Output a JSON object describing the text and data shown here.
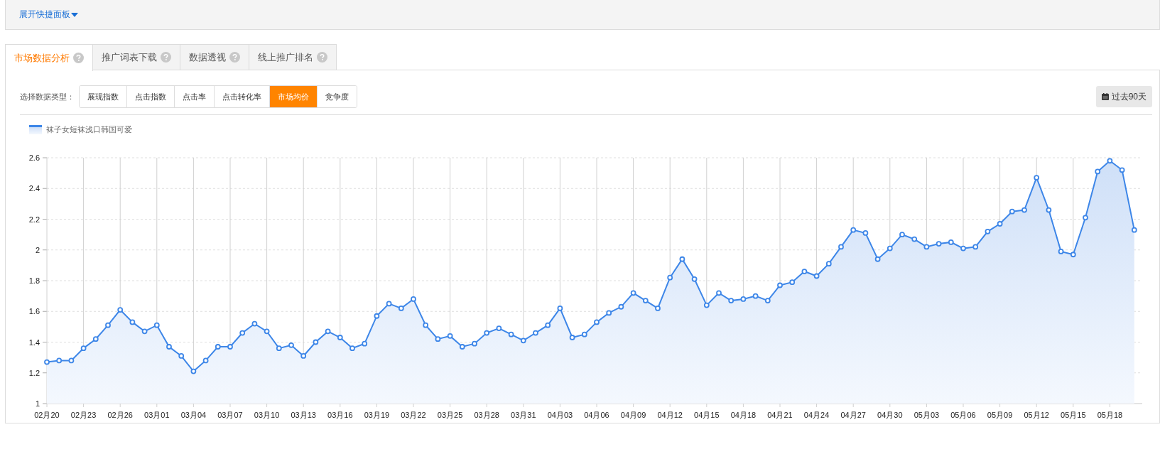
{
  "quick_panel": {
    "label": "展开快捷面板"
  },
  "tabs": [
    {
      "label": "市场数据分析",
      "selected": true
    },
    {
      "label": "推广词表下载",
      "selected": false
    },
    {
      "label": "数据透视",
      "selected": false
    },
    {
      "label": "线上推广排名",
      "selected": false
    }
  ],
  "data_type": {
    "label": "选择数据类型：",
    "options": [
      {
        "label": "展现指数",
        "selected": false
      },
      {
        "label": "点击指数",
        "selected": false
      },
      {
        "label": "点击率",
        "selected": false
      },
      {
        "label": "点击转化率",
        "selected": false
      },
      {
        "label": "市场均价",
        "selected": true
      },
      {
        "label": "竞争度",
        "selected": false
      }
    ]
  },
  "period_button": {
    "label": "过去90天"
  },
  "chart": {
    "chart_data": {
      "type": "area",
      "series": [
        {
          "name": "袜子女短袜浅口韩国可爱",
          "color": "#3d86e8",
          "values": [
            1.27,
            1.28,
            1.28,
            1.36,
            1.42,
            1.51,
            1.61,
            1.53,
            1.47,
            1.51,
            1.37,
            1.31,
            1.21,
            1.28,
            1.37,
            1.37,
            1.46,
            1.52,
            1.47,
            1.36,
            1.38,
            1.31,
            1.4,
            1.47,
            1.43,
            1.36,
            1.39,
            1.57,
            1.65,
            1.62,
            1.68,
            1.51,
            1.42,
            1.44,
            1.37,
            1.39,
            1.46,
            1.49,
            1.45,
            1.41,
            1.46,
            1.51,
            1.62,
            1.43,
            1.45,
            1.53,
            1.59,
            1.63,
            1.72,
            1.67,
            1.62,
            1.82,
            1.94,
            1.81,
            1.64,
            1.72,
            1.67,
            1.68,
            1.7,
            1.67,
            1.77,
            1.79,
            1.86,
            1.83,
            1.91,
            2.02,
            2.13,
            2.11,
            1.94,
            2.01,
            2.1,
            2.07,
            2.02,
            2.04,
            2.05,
            2.01,
            2.02,
            2.12,
            2.17,
            2.25,
            2.26,
            2.47,
            2.26,
            1.99,
            1.97,
            2.21,
            2.51,
            2.58,
            2.52,
            2.13
          ]
        }
      ],
      "ylim": [
        1,
        2.6
      ],
      "yticks": [
        {
          "value": 1,
          "label": "1"
        },
        {
          "value": 1.2,
          "label": "1.2"
        },
        {
          "value": 1.4,
          "label": "1.4"
        },
        {
          "value": 1.6,
          "label": "1.6"
        },
        {
          "value": 1.8,
          "label": "1.8"
        },
        {
          "value": 2,
          "label": "2"
        },
        {
          "value": 2.2,
          "label": "2.2"
        },
        {
          "value": 2.4,
          "label": "2.4"
        },
        {
          "value": 2.6,
          "label": "2.6"
        }
      ],
      "grid": true,
      "categories": [
        "02月20",
        null,
        null,
        "02月23",
        null,
        null,
        "02月26",
        null,
        null,
        "03月01",
        null,
        null,
        "03月04",
        null,
        null,
        "03月07",
        null,
        null,
        "03月10",
        null,
        null,
        "03月13",
        null,
        null,
        "03月16",
        null,
        null,
        "03月19",
        null,
        null,
        "03月22",
        null,
        null,
        "03月25",
        null,
        null,
        "03月28",
        null,
        null,
        "03月31",
        null,
        null,
        "04月03",
        null,
        null,
        "04月06",
        null,
        null,
        "04月09",
        null,
        null,
        "04月12",
        null,
        null,
        "04月15",
        null,
        null,
        "04月18",
        null,
        null,
        "04月21",
        null,
        null,
        "04月24",
        null,
        null,
        "04月27",
        null,
        null,
        "04月30",
        null,
        null,
        "05月03",
        null,
        null,
        "05月06",
        null,
        null,
        "05月09",
        null,
        null,
        "05月12",
        null,
        null,
        "05月15",
        null,
        null,
        "05月18",
        null,
        null
      ]
    }
  }
}
